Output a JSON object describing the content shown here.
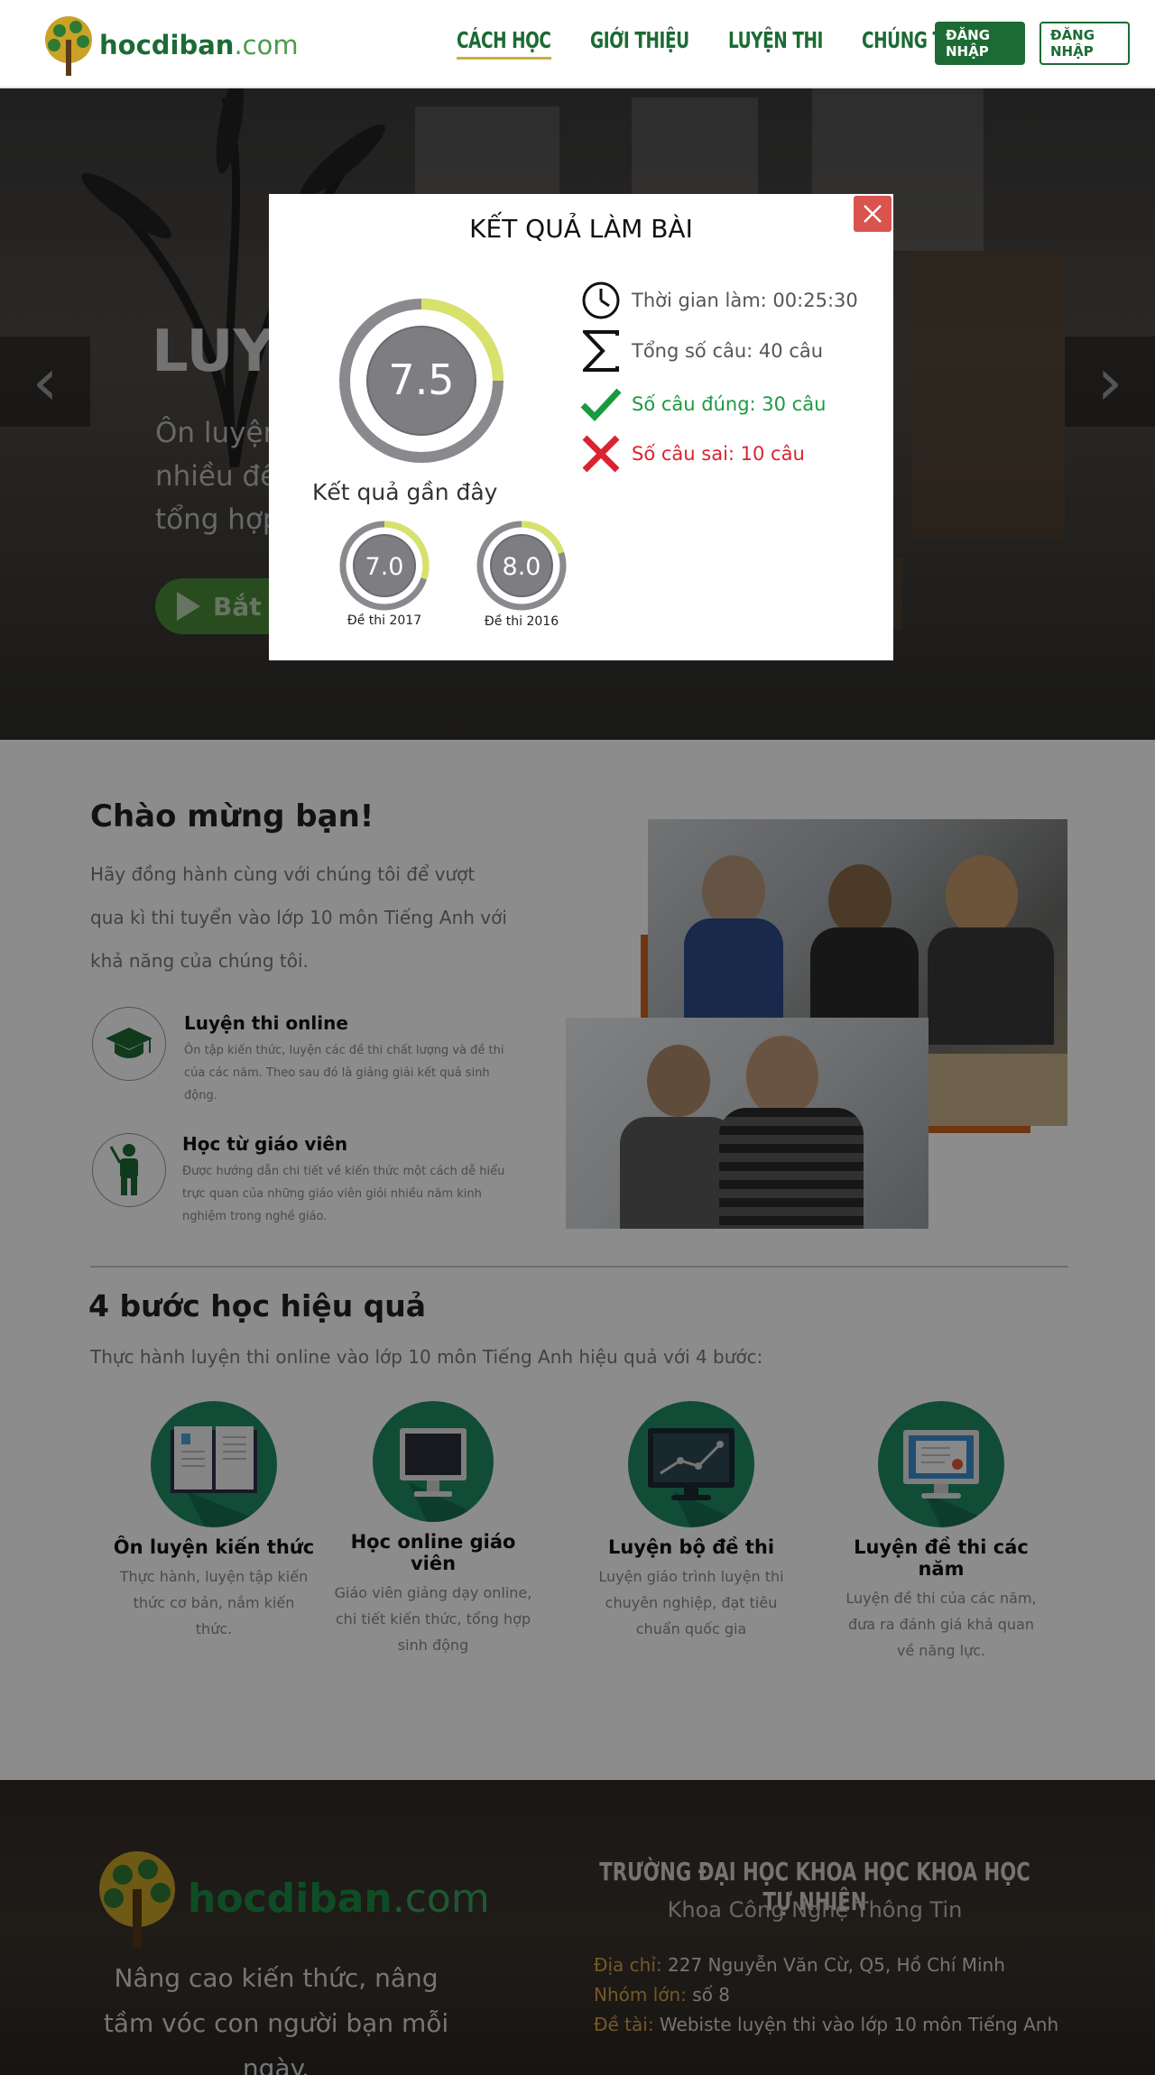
{
  "header": {
    "logo_name": "hocdiban",
    "logo_domain": ".com",
    "nav": [
      {
        "label": "CÁCH HỌC",
        "active": true
      },
      {
        "label": "GIỚI THIỆU"
      },
      {
        "label": "LUYỆN THI"
      },
      {
        "label": "CHÚNG TÔI"
      }
    ],
    "login_solid": "ĐĂNG NHẬP",
    "login_outline": "ĐĂNG NHẬP"
  },
  "hero": {
    "title": "LUYỆ",
    "subtitle_lines": [
      "Ôn luyện",
      "nhiều đề",
      "tổng hợp"
    ],
    "cta": "Bắt",
    "prev": "‹",
    "next": "›"
  },
  "welcome": {
    "title": "Chào mừng bạn!",
    "text": "Hãy đồng hành cùng với chúng tôi để vượt qua kì thi tuyển vào lớp 10 môn Tiếng Anh với khả năng của chúng tôi.",
    "features": [
      {
        "title": "Luyện thi online",
        "desc": "Ôn tập kiến thức, luyện các đề thi chất lượng và đề thi của các năm. Theo sau đó là giảng giải kết quả sinh động.",
        "icon": "graduation-cap-icon"
      },
      {
        "title": "Học từ giáo viên",
        "desc": "Được hướng dẫn chi tiết về kiến thức một cách dễ hiểu trực quan của những giáo viên giỏi nhiều năm kinh nghiệm trong nghề giáo.",
        "icon": "teacher-icon"
      }
    ]
  },
  "steps": {
    "title": "4 bước  học hiệu quả",
    "subtitle": "Thực hành luyện thi online vào lớp 10 môn Tiếng Anh hiệu quả với 4 bước:",
    "items": [
      {
        "title": "Ôn luyện kiến thức",
        "desc": "Thực hành, luyện tập kiến thức cơ bản, nắm kiến thức.",
        "icon": "book-icon"
      },
      {
        "title": "Học online giáo viên",
        "desc": "Giáo viên giảng dạy online, chi tiết kiến thức, tổng hợp sinh động",
        "icon": "monitor-icon"
      },
      {
        "title": "Luyện bộ đề thi",
        "desc": "Luyện giáo trình luyện thi chuyên nghiệp, đạt tiêu chuẩn quốc gia",
        "icon": "chart-monitor-icon"
      },
      {
        "title": "Luyện đề thi các năm",
        "desc": "Luyện đề thi của các năm, đưa ra đánh giá khả quan về năng lực.",
        "icon": "certificate-icon"
      }
    ]
  },
  "footer": {
    "logo_name": "hocdiban",
    "logo_domain": ".com",
    "tagline": "Nâng cao kiến thức, nâng tầm vóc con người bạn mỗi ngày.",
    "school": "TRƯỜNG ĐẠI HỌC KHOA HỌC KHOA HỌC TỰ NHIÊN",
    "faculty": "Khoa Công Nghệ Thông Tin",
    "info": [
      {
        "label": "Địa chỉ:",
        "value": "227 Nguyễn Văn Cừ, Q5, Hồ Chí Minh"
      },
      {
        "label": "Nhóm lớn:",
        "value": "số 8"
      },
      {
        "label": "Đề tài:",
        "value": "Webiste luyện thi vào lớp 10 môn Tiếng Anh"
      }
    ]
  },
  "modal": {
    "title": "KẾT QUẢ LÀM BÀI",
    "score": "7.5",
    "score_fraction": 0.75,
    "recent_title": "Kết quả gần đây",
    "recent": [
      {
        "score": "7.0",
        "fraction": 0.7,
        "label": "Đề thi 2017"
      },
      {
        "score": "8.0",
        "fraction": 0.8,
        "label": "Đề thi 2016"
      }
    ],
    "stats": [
      {
        "text": "Thời gian làm: 00:25:30",
        "icon": "clock-icon"
      },
      {
        "text": "Tổng số câu: 40 câu",
        "icon": "sigma-icon"
      },
      {
        "text": "Số câu đúng: 30 câu",
        "icon": "check-icon"
      },
      {
        "text": "Số câu sai: 10 câu",
        "icon": "cross-icon"
      }
    ]
  },
  "colors": {
    "brand_green": "#1c6b34",
    "accent_yellow": "#d8e26a",
    "ok": "#1a9a40",
    "bad": "#d9232e",
    "close": "#d9534f"
  }
}
